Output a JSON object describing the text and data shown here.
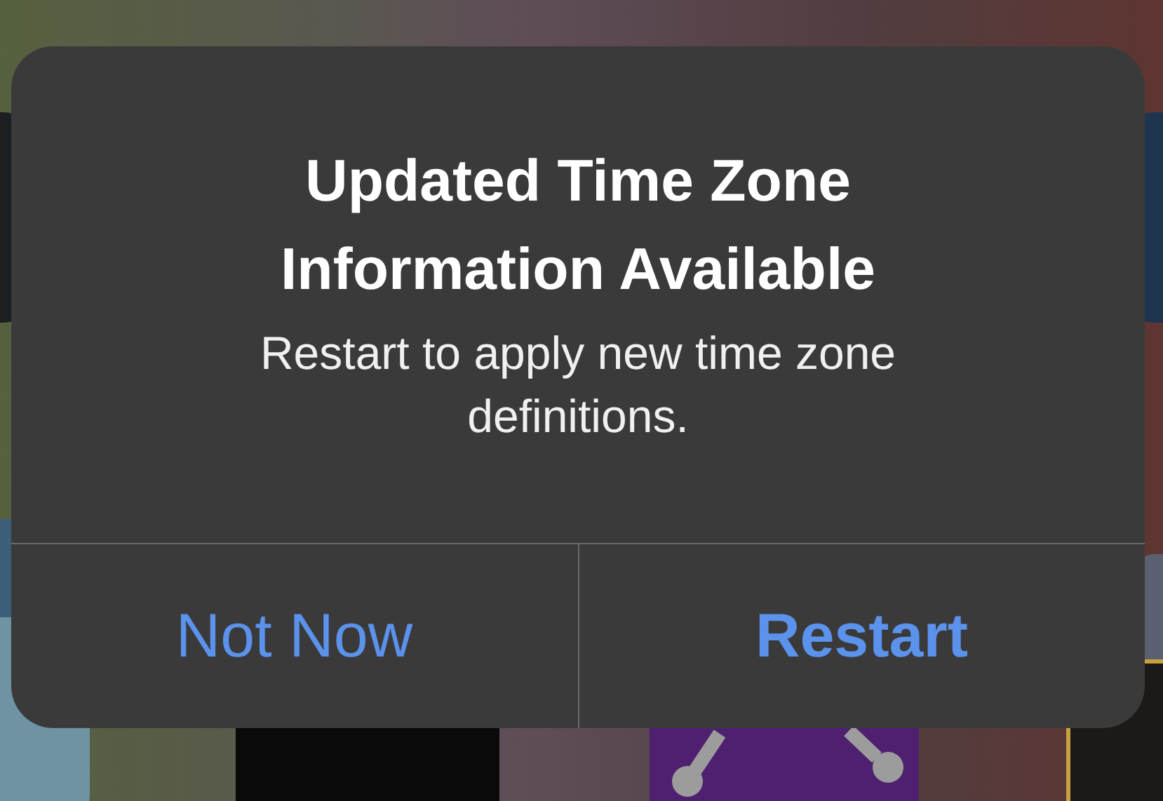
{
  "alert": {
    "title": "Updated Time Zone Information Available",
    "message": "Restart to apply new time zone definitions.",
    "buttons": [
      {
        "label": "Not Now",
        "bold": false
      },
      {
        "label": "Restart",
        "bold": true
      }
    ]
  }
}
